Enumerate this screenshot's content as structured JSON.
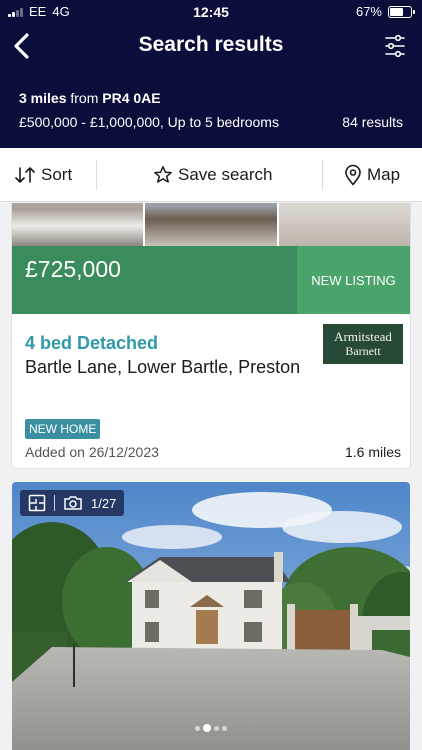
{
  "status": {
    "carrier": "EE",
    "network": "4G",
    "time": "12:45",
    "battery": "67%",
    "battery_level": 0.67
  },
  "header": {
    "title": "Search results"
  },
  "summary": {
    "radius": "3 miles",
    "from_text": "from",
    "postcode": "PR4 0AE",
    "criteria": "£500,000 - £1,000,000, Up to 5 bedrooms",
    "results": "84 results"
  },
  "toolbar": {
    "sort_label": "Sort",
    "save_label": "Save search",
    "map_label": "Map"
  },
  "listings": [
    {
      "price": "£725,000",
      "tag": "NEW LISTING",
      "type": "4 bed Detached",
      "address": "Bartle Lane, Lower Bartle, Preston",
      "agent_line1": "Armitstead",
      "agent_line2": "Barnett",
      "badge": "NEW HOME",
      "added": "Added on 26/12/2023",
      "distance": "1.6 miles"
    },
    {
      "photo_counter": "1/27"
    }
  ],
  "colors": {
    "navy": "#0b0e3a",
    "green": "#3b8c5c",
    "accent_green": "#4aa46b",
    "teal": "#2f9aa8"
  }
}
